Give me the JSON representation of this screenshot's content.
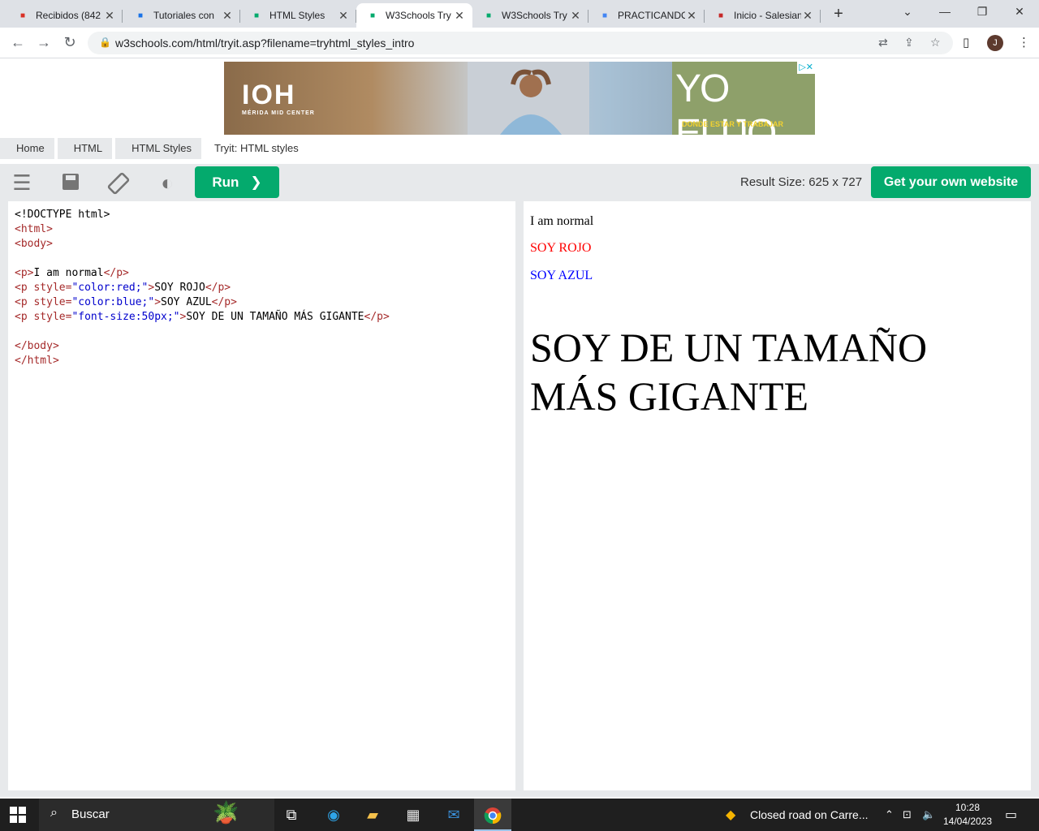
{
  "browser": {
    "tabs": [
      {
        "title": "Recibidos (842",
        "favicon": "gmail-icon",
        "color": "#d93025"
      },
      {
        "title": "Tutoriales con",
        "favicon": "classroom-icon",
        "color": "#1a73e8"
      },
      {
        "title": "HTML Styles",
        "favicon": "w3schools-icon",
        "color": "#04aa6d"
      },
      {
        "title": "W3Schools Try",
        "favicon": "w3schools-icon",
        "color": "#04aa6d",
        "active": true
      },
      {
        "title": "W3Schools Try",
        "favicon": "w3schools-icon",
        "color": "#04aa6d"
      },
      {
        "title": "PRACTICANDO",
        "favicon": "docs-icon",
        "color": "#4285f4"
      },
      {
        "title": "Inicio - Salesian",
        "favicon": "salesian-icon",
        "color": "#c62828"
      }
    ],
    "new_tab_label": "+",
    "url": "w3schools.com/html/tryit.asp?filename=tryhtml_styles_intro",
    "avatar_letter": "J"
  },
  "ad": {
    "brand": "IOH",
    "brand_sub": "MÉRIDA MID CENTER",
    "slogan": "YO ELIJO",
    "tagline": "DONDE ESTAR Y TRABAJAR"
  },
  "breadcrumb": [
    "Home",
    "HTML",
    "HTML Styles",
    "Tryit: HTML styles"
  ],
  "toolbar": {
    "run_label": "Run",
    "result_size": "Result Size: 625 x 727",
    "get_website_label": "Get your own website"
  },
  "editor": {
    "lines": [
      [
        {
          "t": "<!DOCTYPE html>",
          "c": "tx"
        }
      ],
      [
        {
          "t": "<html>",
          "c": "tg"
        }
      ],
      [
        {
          "t": "<body>",
          "c": "tg"
        }
      ],
      [],
      [
        {
          "t": "<p>",
          "c": "tg"
        },
        {
          "t": "I am normal",
          "c": "tx"
        },
        {
          "t": "</p>",
          "c": "tg"
        }
      ],
      [
        {
          "t": "<p ",
          "c": "tg"
        },
        {
          "t": "style=",
          "c": "at"
        },
        {
          "t": "\"color:red;\"",
          "c": "av"
        },
        {
          "t": ">",
          "c": "tg"
        },
        {
          "t": "SOY ROJO",
          "c": "tx"
        },
        {
          "t": "</p>",
          "c": "tg"
        }
      ],
      [
        {
          "t": "<p ",
          "c": "tg"
        },
        {
          "t": "style=",
          "c": "at"
        },
        {
          "t": "\"color:blue;\"",
          "c": "av"
        },
        {
          "t": ">",
          "c": "tg"
        },
        {
          "t": "SOY AZUL",
          "c": "tx"
        },
        {
          "t": "</p>",
          "c": "tg"
        }
      ],
      [
        {
          "t": "<p ",
          "c": "tg"
        },
        {
          "t": "style=",
          "c": "at"
        },
        {
          "t": "\"font-size:50px;\"",
          "c": "av"
        },
        {
          "t": ">",
          "c": "tg"
        },
        {
          "t": "SOY DE UN TAMAÑO MÁS GIGANTE",
          "c": "tx"
        },
        {
          "t": "</p>",
          "c": "tg"
        }
      ],
      [],
      [
        {
          "t": "</body>",
          "c": "tg"
        }
      ],
      [
        {
          "t": "</html>",
          "c": "tg"
        }
      ]
    ]
  },
  "result": {
    "p1": "I am normal",
    "p2": "SOY ROJO",
    "p3": "SOY AZUL",
    "p4": "SOY DE UN TAMAÑO MÁS GIGANTE"
  },
  "taskbar": {
    "search_label": "Buscar",
    "notification": "Closed road on Carre...",
    "time": "10:28",
    "date": "14/04/2023"
  }
}
